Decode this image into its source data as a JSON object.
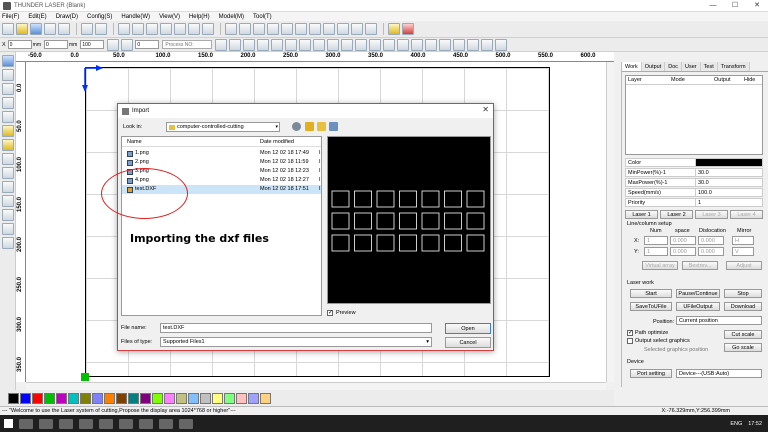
{
  "window": {
    "title": "THUNDER LASER (Blank)",
    "min": "—",
    "max": "☐",
    "close": "✕"
  },
  "menu": [
    "File(F)",
    "Edit(E)",
    "Draw(D)",
    "Config(S)",
    "Handle(W)",
    "View(V)",
    "Help(H)",
    "Model(M)",
    "Tool(T)"
  ],
  "toolbar2": {
    "x_label": "X",
    "x_value": "0",
    "x_unit": "mm",
    "y_label": "Y",
    "y_value": "0",
    "y_unit": "mm",
    "w_value": "0",
    "w_unit": "mm",
    "h_value": "0",
    "h_unit": "mm",
    "pct1": "100",
    "pct2": "100",
    "angle": "0",
    "process_no_placeholder": "Process NO:"
  },
  "ruler_top": [
    "-50.0",
    "0.0",
    "50.0",
    "100.0",
    "150.0",
    "200.0",
    "250.0",
    "300.0",
    "350.0",
    "400.0",
    "450.0",
    "500.0",
    "550.0",
    "600.0",
    "650.0"
  ],
  "ruler_left": [
    "0.0",
    "50.0",
    "100.0",
    "150.0",
    "200.0",
    "250.0",
    "300.0",
    "350.0",
    "400.0"
  ],
  "palette": [
    "#000000",
    "#0000ff",
    "#ff0000",
    "#00c000",
    "#c000c0",
    "#00c0c0",
    "#808000",
    "#8080ff",
    "#ff8000",
    "#804000",
    "#008080",
    "#800080",
    "#80ff00",
    "#ff80ff",
    "#c0c080",
    "#80c0ff",
    "#c0c0c0",
    "#ffff80",
    "#80ff80",
    "#ffc0c0",
    "#a0a0ff",
    "#ffd080"
  ],
  "status": {
    "message": "--- \"Welcome to use the Laser system of cutting,Propose the display area 1024*768 or higher\"---",
    "coords": "X:-76.329mm,Y:256.399mm"
  },
  "taskbar": {
    "lang": "ENG",
    "time": "17:52"
  },
  "right_panel": {
    "tabs": [
      "Work",
      "Output",
      "Doc",
      "User",
      "Test",
      "Transform"
    ],
    "layer_headers": [
      "Layer",
      "Mode",
      "Output",
      "Hide"
    ],
    "props": [
      {
        "k": "Color",
        "v": ""
      },
      {
        "k": "MinPower(%)-1",
        "v": "30.0"
      },
      {
        "k": "MaxPower(%)-1",
        "v": "30.0"
      },
      {
        "k": "Speed(mm/s)",
        "v": "100.0"
      },
      {
        "k": "Priority",
        "v": "1"
      }
    ],
    "laser_tabs": [
      "Laser 1",
      "Laser 2",
      "Laser 3",
      "Laser 4"
    ],
    "line_col_title": "Line/column setup",
    "lc_headers": [
      "Num",
      "space",
      "Dislocation",
      "Mirror"
    ],
    "lc_x": {
      "label": "X:",
      "num": "1",
      "space": "0.000",
      "disloc": "0.000",
      "mirror": "H"
    },
    "lc_y": {
      "label": "Y:",
      "num": "1",
      "space": "0.000",
      "disloc": "0.000",
      "mirror": "V"
    },
    "lc_buttons": [
      "Virtual array",
      "Bestrev...",
      "Adjust"
    ],
    "laser_work_title": "Laser work",
    "work_buttons": [
      "Start",
      "Pause/Continue",
      "Stop",
      "SaveToUFile",
      "UFileOutput",
      "Download"
    ],
    "position_label": "Position:",
    "position_value": "Current position",
    "path_optimize": "Path optimize",
    "output_select": "Output select graphics",
    "selected_pos": "Selected graphics position",
    "cut_scale": "Cut scale",
    "go_scale": "Go scale",
    "device_title": "Device",
    "port_setting": "Port setting",
    "device_value": "Device---(USB:Auto)"
  },
  "dialog": {
    "title": "Import",
    "close": "✕",
    "look_in_label": "Look in:",
    "look_in_value": "computer-controlled-cutting",
    "col_name": "Name",
    "col_date": "Date modified",
    "files": [
      {
        "name": "1.png",
        "date": "Mon 12 02 18 17:49",
        "trunc": "I"
      },
      {
        "name": "2.png",
        "date": "Mon 12 02 18 11:59",
        "trunc": "I"
      },
      {
        "name": "3.png",
        "date": "Mon 12 02 18 12:23",
        "trunc": "I"
      },
      {
        "name": "4.png",
        "date": "Mon 12 02 18 12:27",
        "trunc": "I"
      },
      {
        "name": "test.DXF",
        "date": "Mon 12 02 18 17:51",
        "trunc": "I"
      }
    ],
    "preview_label": "Preview",
    "file_name_label": "File name:",
    "file_name_value": "test.DXF",
    "file_type_label": "Files of type:",
    "file_type_value": "Supported Files1",
    "open": "Open",
    "cancel": "Cancel"
  },
  "annotation": "Importing the dxf files"
}
